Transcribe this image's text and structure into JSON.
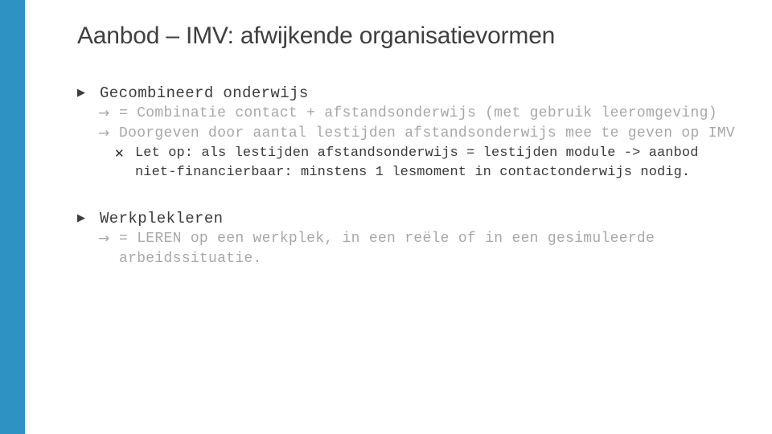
{
  "slide": {
    "title": "Aanbod – IMV: afwijkende organisatievormen",
    "accent_color": "#2e92c2",
    "background_color": "#ffffff",
    "title_color": "#3f3f3f"
  },
  "bullets": {
    "level1_marker": "▶",
    "level2_marker": "→",
    "level3_marker": "✕",
    "level1_color": "#3c3c3c",
    "level2_color": "#a8a8a8",
    "level3_color": "#3a3a3a"
  },
  "content": {
    "groups": [
      {
        "heading": "Gecombineerd onderwijs",
        "items": [
          {
            "level": 2,
            "text": "= Combinatie contact + afstandsonderwijs (met gebruik leeromgeving)"
          },
          {
            "level": 2,
            "text": "Doorgeven door aantal lestijden afstandsonderwijs mee te geven op IMV"
          },
          {
            "level": 3,
            "text": "Let op: als lestijden afstandsonderwijs = lestijden module -> aanbod niet-financierbaar: minstens 1 lesmoment in contactonderwijs nodig."
          }
        ]
      },
      {
        "heading": "Werkplekleren",
        "items": [
          {
            "level": 2,
            "text": "= LEREN op een werkplek, in een reële of in een gesimuleerde arbeidssituatie."
          }
        ]
      }
    ]
  }
}
